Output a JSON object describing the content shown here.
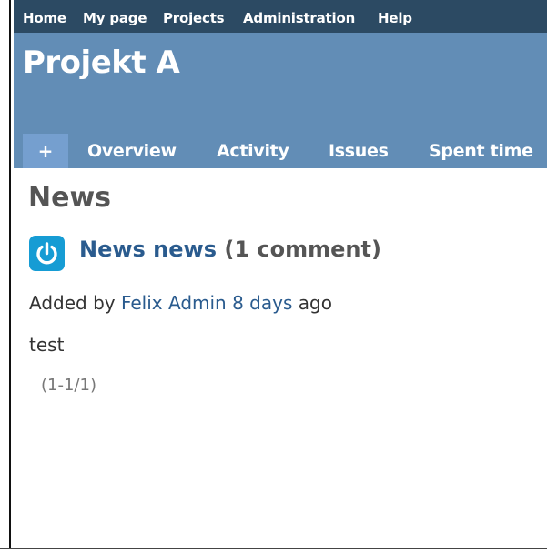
{
  "top_menu": {
    "items": [
      "Home",
      "My page",
      "Projects",
      "Administration",
      "Help"
    ]
  },
  "project": {
    "title": "Projekt A"
  },
  "tabs": {
    "new_label": "+",
    "items": [
      "Overview",
      "Activity",
      "Issues",
      "Spent time"
    ]
  },
  "page": {
    "heading": "News"
  },
  "news_item": {
    "icon": "power-icon",
    "title": "News news",
    "comment_count": "(1 comment)",
    "added_by_prefix": "Added by",
    "author": "Felix Admin",
    "age": "8 days",
    "age_suffix": "ago",
    "body": "test"
  },
  "pagination": {
    "text": "(1-1/1)"
  },
  "colors": {
    "top_menu_bg": "#2c4a63",
    "header_bg": "#628db6",
    "selected_tab_bg": "#759fcf",
    "link": "#2a5b8e",
    "news_icon_bg": "#169cd4"
  }
}
